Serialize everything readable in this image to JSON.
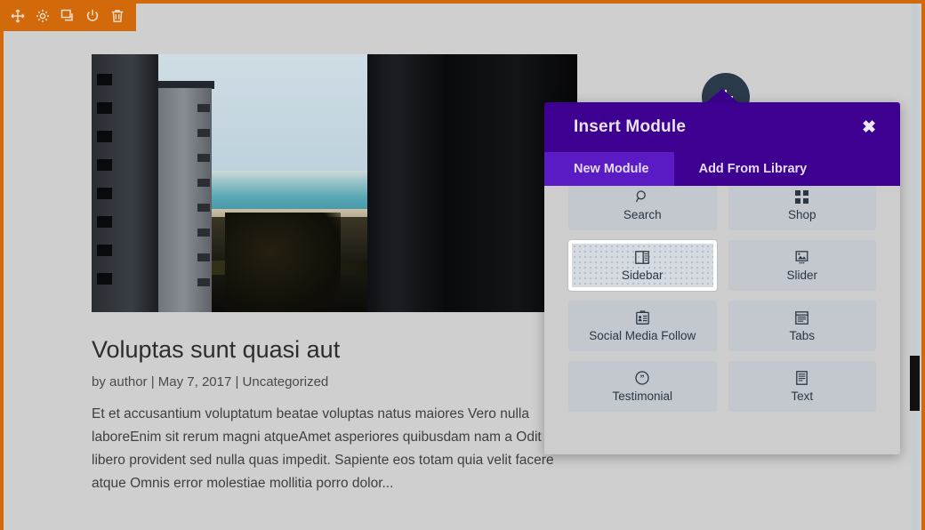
{
  "toolbar": {
    "buttons": [
      {
        "name": "move-icon",
        "label": "Move"
      },
      {
        "name": "settings-gear-icon",
        "label": "Settings"
      },
      {
        "name": "duplicate-icon",
        "label": "Duplicate"
      },
      {
        "name": "disable-power-icon",
        "label": "Disable"
      },
      {
        "name": "trash-icon",
        "label": "Delete"
      }
    ]
  },
  "post": {
    "title": "Voluptas sunt quasi aut",
    "meta": "by author | May 7, 2017 | Uncategorized",
    "excerpt": "Et et accusantium voluptatum beatae voluptas natus maiores Vero nulla laboreEnim sit rerum magni atqueAmet asperiores quibusdam nam a Odit libero provident sed nulla quas impedit. Sapiente eos totam quia velit facere atque Omnis error molestiae mollitia porro dolor...",
    "featured_image_alt": "City buildings overlooking the sea"
  },
  "add_button": {
    "label": "+",
    "name": "add-module-button"
  },
  "modal": {
    "title": "Insert Module",
    "close_label": "✖",
    "tabs": [
      {
        "label": "New Module",
        "active": true
      },
      {
        "label": "Add From Library",
        "active": false
      }
    ],
    "modules": [
      {
        "label": "Search",
        "icon": "search-icon",
        "hovered": false
      },
      {
        "label": "Shop",
        "icon": "shop-grid-icon",
        "hovered": false
      },
      {
        "label": "Sidebar",
        "icon": "sidebar-icon",
        "hovered": true
      },
      {
        "label": "Slider",
        "icon": "slider-image-icon",
        "hovered": false
      },
      {
        "label": "Social Media Follow",
        "icon": "social-media-follow-icon",
        "hovered": false
      },
      {
        "label": "Tabs",
        "icon": "tabs-icon",
        "hovered": false
      },
      {
        "label": "Testimonial",
        "icon": "testimonial-quote-icon",
        "hovered": false
      },
      {
        "label": "Text",
        "icon": "text-document-icon",
        "hovered": false
      }
    ]
  },
  "colors": {
    "accent_orange": "#d2690a",
    "modal_header_purple": "#3d0091",
    "modal_tab_active_purple": "#5b1bc4",
    "page_background": "#cfcfcf",
    "tile_background": "#c2c8ce",
    "add_button_navy": "#2b3a4a"
  },
  "scrollbar": {
    "name": "vertical-scrollbar",
    "position_label": "scrolled"
  }
}
